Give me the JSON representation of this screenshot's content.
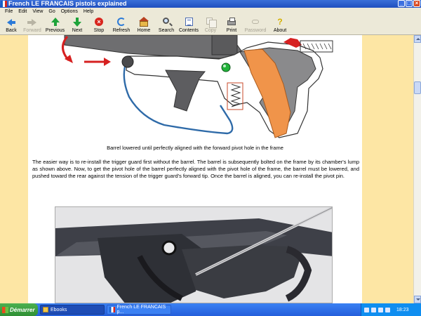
{
  "window": {
    "title": "French LE FRANCAIS pistols explained"
  },
  "menu": [
    "File",
    "Edit",
    "View",
    "Go",
    "Options",
    "Help"
  ],
  "toolbar": [
    {
      "label": "Back",
      "icon": "back-arrow-icon",
      "enabled": true
    },
    {
      "label": "Forward",
      "icon": "forward-arrow-icon",
      "enabled": false
    },
    {
      "label": "Previous",
      "icon": "previous-arrow-icon",
      "enabled": true
    },
    {
      "label": "Next",
      "icon": "next-arrow-icon",
      "enabled": true
    },
    {
      "label": "Stop",
      "icon": "stop-icon",
      "enabled": true
    },
    {
      "label": "Refresh",
      "icon": "refresh-icon",
      "enabled": true
    },
    {
      "label": "Home",
      "icon": "home-icon",
      "enabled": true
    },
    {
      "label": "Search",
      "icon": "search-icon",
      "enabled": true
    },
    {
      "label": "Contents",
      "icon": "contents-icon",
      "enabled": true
    },
    {
      "label": "Copy",
      "icon": "copy-icon",
      "enabled": false
    },
    {
      "label": "Print",
      "icon": "print-icon",
      "enabled": true
    },
    {
      "label": "Password",
      "icon": "password-icon",
      "enabled": false
    },
    {
      "label": "About",
      "icon": "about-icon",
      "enabled": true
    }
  ],
  "page": {
    "caption": "Barrel lowered until perfectly aligned with the forward pivot hole in the frame",
    "body": "The easier way is to re-install the trigger guard first without the barrel. The barrel is subsequently bolted on the frame by its chamber's lump as shown above. Now, to get the pivot hole of the barrel perfectly aligned with the pivot hole of the frame, the barrel must be lowered, and pushed toward the rear against the tension of the trigger guard's forward tip. Once the barrel is aligned, you can re-install the pivot pin."
  },
  "taskbar": {
    "start_label": "Démarrer",
    "tasks": [
      "Ebooks",
      "French LE FRANCAIS p..."
    ],
    "clock": "18:23"
  },
  "colors": {
    "page_margin": "#fde6a4",
    "page_background": "#ffffff",
    "taskbar": "#245edb"
  }
}
